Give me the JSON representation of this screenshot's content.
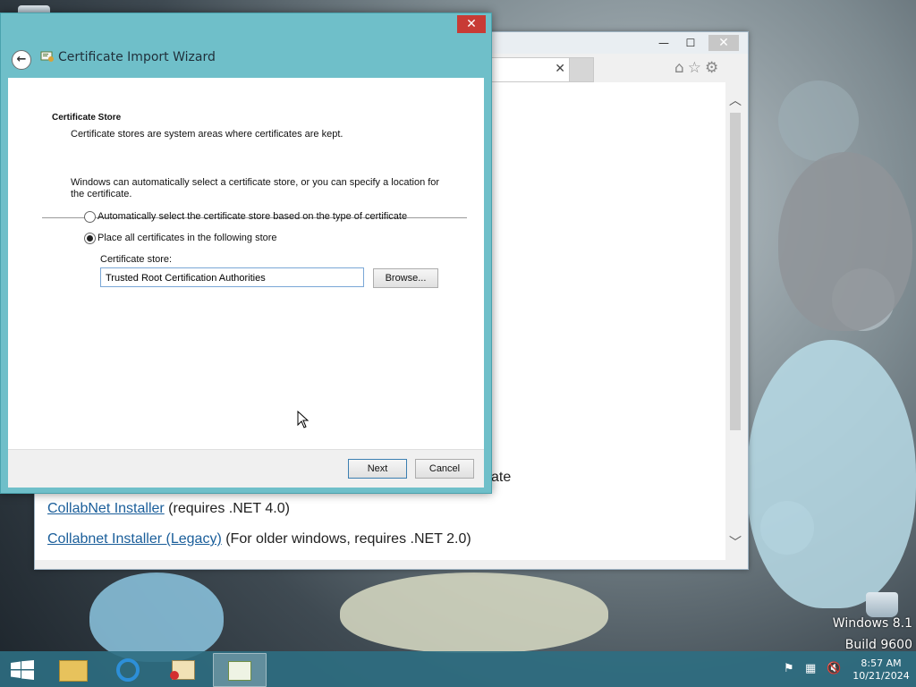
{
  "wizard": {
    "title": "Certificate Import Wizard",
    "close_glyph": "✕",
    "back_glyph": "←",
    "section_heading": "Certificate Store",
    "section_description": "Certificate stores are system areas where certificates are kept.",
    "intro_line1": "Windows can automatically select a certificate store, or you can specify a location for",
    "intro_line2": "the certificate.",
    "option_auto": "Automatically select the certificate store based on the type of certificate",
    "option_place": "Place all certificates in the following store",
    "selected_option": "place",
    "store_label": "Certificate store:",
    "store_value": "Trusted Root Certification Authorities",
    "browse_label": "Browse...",
    "next_label": "Next",
    "cancel_label": "Cancel"
  },
  "browser": {
    "controls": {
      "minimize": "—",
      "maximize": "☐",
      "close": "✕"
    },
    "tab_close": "✕",
    "toolbar_icons": "⌂☆⚙",
    "partial_text": "ate",
    "links": [
      {
        "link": "CollabNet Installer",
        "rest": " (requires .NET 4.0)"
      },
      {
        "link": "Collabnet Installer (Legacy)",
        "rest": " (For older windows, requires .NET 2.0)"
      }
    ]
  },
  "desktop": {
    "watermark_line1": "Windows 8.1",
    "watermark_line2": "Build 9600"
  },
  "taskbar": {
    "clock_time": "8:57 AM",
    "clock_date": "10/21/2024"
  }
}
